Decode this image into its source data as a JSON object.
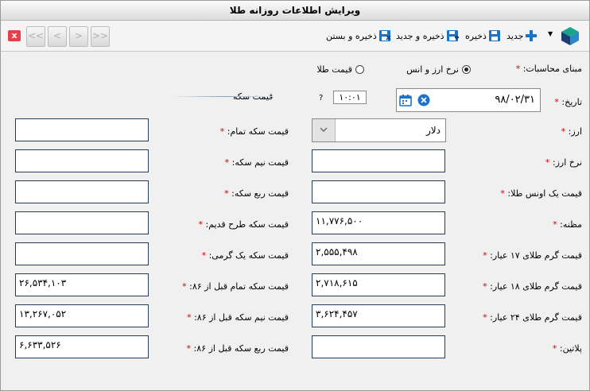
{
  "window": {
    "title": "ویرایش اطلاعات روزانه طلا"
  },
  "toolbar": {
    "new_label": "جدید",
    "save_label": "ذخیره",
    "save_new_label": "ذخیره و جدید",
    "save_close_label": "ذخیره و بستن"
  },
  "nav": {
    "last": "<<",
    "prev": "<",
    "next": ">",
    "first": ">>"
  },
  "close": {
    "glyph": "x"
  },
  "basis": {
    "label": "مبنای محاسبات:",
    "opt_rate": "نرخ ارز و انس",
    "opt_gold": "قیمت طلا",
    "selected": "نرخ ارز و انس"
  },
  "date": {
    "label": "تاریخ:",
    "value": "۹۸/۰۲/۳۱"
  },
  "time": {
    "value": "۱۰:۰۱",
    "question": "?"
  },
  "coin_header": "قیمت سکه",
  "left_fields": [
    {
      "label": "ارز:",
      "value": "دلار",
      "type": "select"
    },
    {
      "label": "نرخ ارز:",
      "value": ""
    },
    {
      "label": "قیمت یک اونس طلا:",
      "value": ""
    },
    {
      "label": "مظنه:",
      "value": "۱۱,۷۷۶,۵۰۰"
    },
    {
      "label": "قیمت گرم طلای ۱۷ عیار:",
      "value": "۲,۵۵۵,۴۹۸"
    },
    {
      "label": "قیمت گرم طلای ۱۸ عیار:",
      "value": "۲,۷۱۸,۶۱۵"
    },
    {
      "label": "قیمت گرم طلای ۲۴ عیار:",
      "value": "۳,۶۲۴,۴۵۷"
    },
    {
      "label": "پلاتین:",
      "value": ""
    }
  ],
  "right_fields": [
    {
      "label": "قیمت سکه تمام:",
      "value": ""
    },
    {
      "label": "قیمت نیم سکه:",
      "value": ""
    },
    {
      "label": "قیمت ربع سکه:",
      "value": ""
    },
    {
      "label": "قیمت سکه طرح قدیم:",
      "value": ""
    },
    {
      "label": "قیمت سکه یک گرمی:",
      "value": ""
    },
    {
      "label": "قیمت سکه تمام قبل از ۸۶:",
      "value": "۲۶,۵۳۴,۱۰۳"
    },
    {
      "label": "قیمت نیم سکه قبل از ۸۶:",
      "value": "۱۳,۲۶۷,۰۵۲"
    },
    {
      "label": "قیمت ربع سکه قبل از ۸۶:",
      "value": "۶,۶۳۳,۵۲۶"
    }
  ],
  "colors": {
    "accent": "#1a73c9",
    "close": "#e8404a",
    "field_border": "#243b5a"
  }
}
